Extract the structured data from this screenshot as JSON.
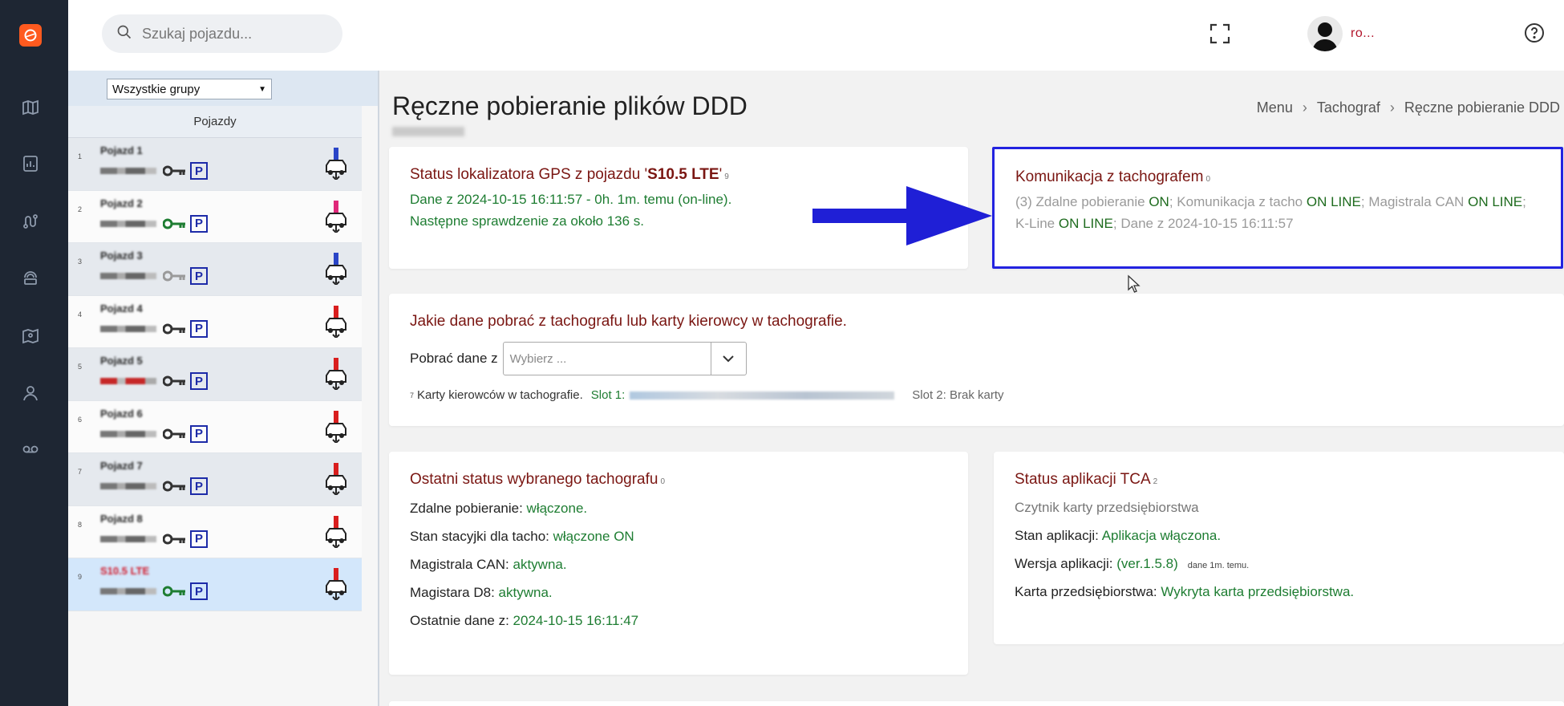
{
  "search": {
    "placeholder": "Szukaj pojazdu..."
  },
  "user": {
    "name": "ro..."
  },
  "sidebar": {
    "group_select": "Wszystkie grupy",
    "column_header": "Pojazdy",
    "vehicles": [
      {
        "idx": "1",
        "name": "Pojazd 1",
        "key_color": "#333333"
      },
      {
        "idx": "2",
        "name": "Pojazd 2",
        "key_color": "#1e7d32"
      },
      {
        "idx": "3",
        "name": "Pojazd 3",
        "key_color": "#9a9a9a"
      },
      {
        "idx": "4",
        "name": "Pojazd 4",
        "key_color": "#333333"
      },
      {
        "idx": "5",
        "name": "Pojazd 5",
        "key_color": "#333333"
      },
      {
        "idx": "6",
        "name": "Pojazd 6",
        "key_color": "#333333"
      },
      {
        "idx": "7",
        "name": "Pojazd 7",
        "key_color": "#333333"
      },
      {
        "idx": "8",
        "name": "Pojazd 8",
        "key_color": "#333333"
      },
      {
        "idx": "9",
        "name": "S10.5 LTE",
        "key_color": "#1e7d32"
      }
    ]
  },
  "page": {
    "title": "Ręczne pobieranie plików DDD",
    "breadcrumb": [
      "Menu",
      "Tachograf",
      "Ręczne pobieranie DDD"
    ]
  },
  "gps_card": {
    "title_prefix": "Status lokalizatora GPS z pojazdu '",
    "vehicle": "S10.5 LTE",
    "title_suffix": "'",
    "title_index": "9",
    "line1": "Dane z 2024-10-15 16:11:57 - 0h. 1m. temu (on-line).",
    "line2": "Następne sprawdzenie za około 136 s."
  },
  "tacho_card": {
    "title": "Komunikacja z tachografem",
    "title_index": "0",
    "part1": "(3) Zdalne pobieranie ",
    "v1": "ON",
    "part2": "; Komunikacja z tacho ",
    "v2": "ON LINE",
    "part3": "; Magistrala CAN ",
    "v3": "ON LINE",
    "part4": "; K-Line ",
    "v4": "ON LINE",
    "part5": "; Dane z 2024-10-15 16:11:57"
  },
  "download_card": {
    "title": "Jakie dane pobrać z tachografu lub karty kierowcy w tachografie.",
    "label": "Pobrać dane z",
    "select_placeholder": "Wybierz ...",
    "cards_index": "7",
    "cards_label": "Karty kierowców w tachografie.",
    "slot1_label": "Slot 1:",
    "slot2_label": "Slot 2: Brak karty"
  },
  "last_status_card": {
    "title": "Ostatni status wybranego tachografu",
    "title_index": "0",
    "rows": [
      {
        "label": "Zdalne pobieranie: ",
        "value": "włączone."
      },
      {
        "label": "Stan stacyjki dla tacho: ",
        "value": "włączone ON"
      },
      {
        "label": "Magistrala CAN: ",
        "value": "aktywna."
      },
      {
        "label": "Magistara D8: ",
        "value": "aktywna."
      },
      {
        "label": "Ostatnie dane z: ",
        "value": "2024-10-15 16:11:47"
      }
    ]
  },
  "tca_card": {
    "title": "Status aplikacji TCA",
    "title_index": "2",
    "subtitle": "Czytnik karty przedsiębiorstwa",
    "state_label": "Stan aplikacji: ",
    "state_value": "Aplikacja włączona.",
    "version_label": "Wersja aplikacji: ",
    "version_value": "(ver.1.5.8)",
    "version_note": "dane 1m. temu.",
    "company_label": "Karta przedsiębiorstwa: ",
    "company_value": "Wykryta karta przedsiębiorstwa."
  },
  "colors": {
    "rail": "#1e2633",
    "title_red": "#7a1612",
    "status_green": "#1e7d32",
    "highlight_blue": "#2323e0"
  }
}
